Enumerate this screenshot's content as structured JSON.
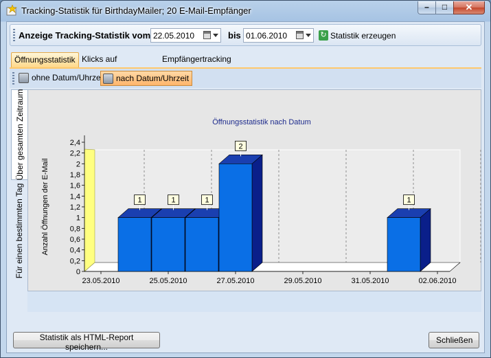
{
  "window": {
    "title": "Tracking-Statistik für BirthdayMailer; 20 E-Mail-Empfänger",
    "min_symbol": "–",
    "max_symbol": "□",
    "close_symbol": "✕"
  },
  "filter": {
    "label": "Anzeige Tracking-Statistik vom:",
    "from_date": "22.05.2010",
    "to_label": "bis",
    "to_date": "01.06.2010",
    "generate_label": "Statistik erzeugen"
  },
  "tabs": [
    {
      "label": "Öffnungsstatistik",
      "active": true
    },
    {
      "label": "Klicks auf Hyperlinks",
      "active": false
    },
    {
      "label": "Empfängertracking",
      "active": false
    }
  ],
  "subtabs": [
    {
      "label": "ohne Datum/Uhrzeit",
      "active": false
    },
    {
      "label": "nach Datum/Uhrzeit",
      "active": true
    }
  ],
  "side_tabs": [
    {
      "label": "Über gesamten Zeitraum",
      "active": true
    },
    {
      "label": "Für einen bestimmten Tag",
      "active": false
    }
  ],
  "chart_data": {
    "type": "bar",
    "title": "Öffnungsstatistik nach Datum",
    "ylabel": "Anzahl Öffnungen der E-Mail",
    "xlabel": "",
    "ylim": [
      0,
      2.4
    ],
    "yticks": [
      "0",
      "0,2",
      "0,4",
      "0,6",
      "0,8",
      "1",
      "1,2",
      "1,4",
      "1,6",
      "1,8",
      "2",
      "2,2",
      "2,4"
    ],
    "xtick_labels": [
      "23.05.2010",
      "25.05.2010",
      "27.05.2010",
      "29.05.2010",
      "31.05.2010",
      "02.06.2010"
    ],
    "categories": [
      "24.05.2010",
      "25.05.2010",
      "26.05.2010",
      "27.05.2010",
      "01.06.2010"
    ],
    "values": [
      1,
      1,
      1,
      2,
      1
    ],
    "data_labels": [
      "1",
      "1",
      "1",
      "2",
      "1"
    ],
    "bar_color": "#0a6fe6",
    "grid": true,
    "style": "3d"
  },
  "footer": {
    "save_label": "Statistik als HTML-Report speichern...",
    "close_label": "Schließen"
  }
}
